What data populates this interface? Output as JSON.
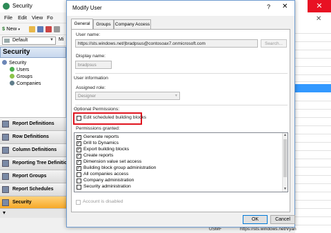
{
  "main_window": {
    "title": "Security",
    "close_glyph": "✕",
    "menu": [
      "File",
      "Edit",
      "View",
      "Fo"
    ],
    "toolbar": {
      "new_label": "New",
      "combo_value": "Default",
      "combo_prefix": "Mi"
    },
    "nav_header": "Security",
    "tree": {
      "root": "Security",
      "children": [
        "Users",
        "Groups",
        "Companies"
      ]
    },
    "nav_buttons": [
      "Report Definitions",
      "Row Definitions",
      "Column Definitions",
      "Reporting Tree Definition",
      "Report Groups",
      "Report Schedules",
      "Security"
    ],
    "active_nav": "Security",
    "status": {
      "col1": "USMF",
      "col2": "https://sts.windows.net/\\ryan"
    },
    "background_close": "✕",
    "accent": "#3399ff"
  },
  "dialog": {
    "title": "Modify User",
    "help_glyph": "?",
    "close_glyph": "✕",
    "tabs": [
      "General",
      "Groups",
      "Company Access"
    ],
    "active_tab": "General",
    "user_name_label": "User name:",
    "user_name_value": "https://sts.windows.net/|bradpsus@contosoax7.onmicrosoft.com",
    "search_button": "Search...",
    "display_name_label": "Display name:",
    "display_name_value": "bradpsus",
    "user_info_label": "User information",
    "assigned_role_label": "Assigned role:",
    "assigned_role_value": "Designer",
    "optional_permissions_label": "Optional Permissions:",
    "edit_scheduled_label": "Edit scheduled building blocks",
    "permissions_granted_label": "Permissions granted:",
    "permissions": [
      {
        "label": "Generate reports",
        "checked": true
      },
      {
        "label": "Drill to Dynamics",
        "checked": true
      },
      {
        "label": "Export building blocks",
        "checked": true
      },
      {
        "label": "Create reports",
        "checked": true
      },
      {
        "label": "Dimension value set access",
        "checked": true
      },
      {
        "label": "Building block group administration",
        "checked": true
      },
      {
        "label": "All companies access",
        "checked": false
      },
      {
        "label": "Company administration",
        "checked": false
      },
      {
        "label": "Security administration",
        "checked": false
      }
    ],
    "account_disabled_label": "Account is disabled",
    "ok_button": "OK",
    "cancel_button": "Cancel",
    "highlight_color": "#e0141e"
  }
}
